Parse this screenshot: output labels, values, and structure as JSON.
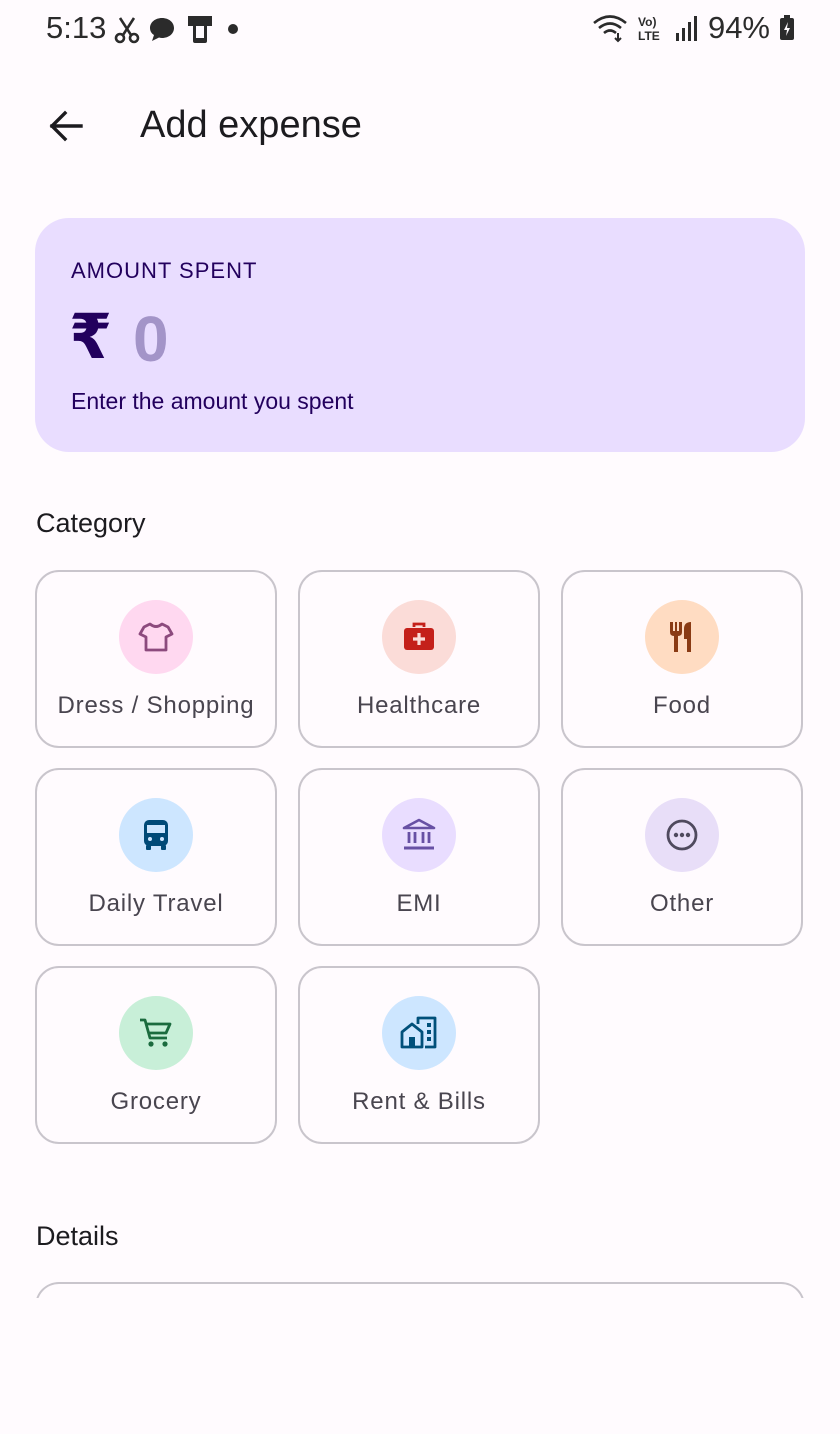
{
  "status_bar": {
    "time": "5:13",
    "battery_percent": "94%"
  },
  "header": {
    "title": "Add expense"
  },
  "amount": {
    "label": "AMOUNT SPENT",
    "currency": "₹",
    "placeholder": "0",
    "value": "",
    "helper": "Enter the amount you spent"
  },
  "category": {
    "title": "Category",
    "items": [
      {
        "label": "Dress / Shopping",
        "icon": "shirt-icon",
        "bg": "#ffd8f0",
        "fg": "#8c4a7d"
      },
      {
        "label": "Healthcare",
        "icon": "medical-bag-icon",
        "bg": "#fbdcd8",
        "fg": "#c4201a"
      },
      {
        "label": "Food",
        "icon": "fork-knife-icon",
        "bg": "#ffdcc2",
        "fg": "#8a3b14"
      },
      {
        "label": "Daily Travel",
        "icon": "bus-icon",
        "bg": "#cde6ff",
        "fg": "#004a77"
      },
      {
        "label": "EMI",
        "icon": "bank-icon",
        "bg": "#e9ddff",
        "fg": "#6750a4"
      },
      {
        "label": "Other",
        "icon": "more-icon",
        "bg": "#e8def8",
        "fg": "#4f4a5e"
      },
      {
        "label": "Grocery",
        "icon": "cart-icon",
        "bg": "#c8efd8",
        "fg": "#1b6b3e"
      },
      {
        "label": "Rent & Bills",
        "icon": "house-building-icon",
        "bg": "#cde6ff",
        "fg": "#00507a"
      }
    ]
  },
  "details": {
    "title": "Details"
  }
}
